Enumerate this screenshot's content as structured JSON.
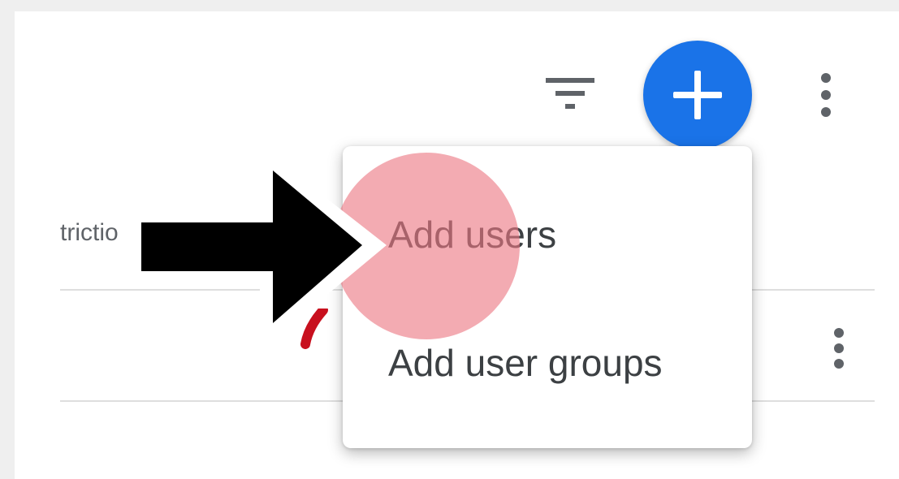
{
  "toolbar": {
    "filter_icon": "filter-list-icon",
    "add_icon": "plus-icon",
    "more_icon": "more-vert-icon",
    "add_button_color": "#1a73e8"
  },
  "table": {
    "column_header_fragment": "trictio",
    "row_more_icon": "more-vert-icon"
  },
  "menu": {
    "items": [
      {
        "label": "Add users"
      },
      {
        "label": "Add user groups"
      }
    ]
  },
  "annotations": {
    "arrow_icon": "pointer-arrow",
    "click_highlight_color": "#ec7882"
  }
}
